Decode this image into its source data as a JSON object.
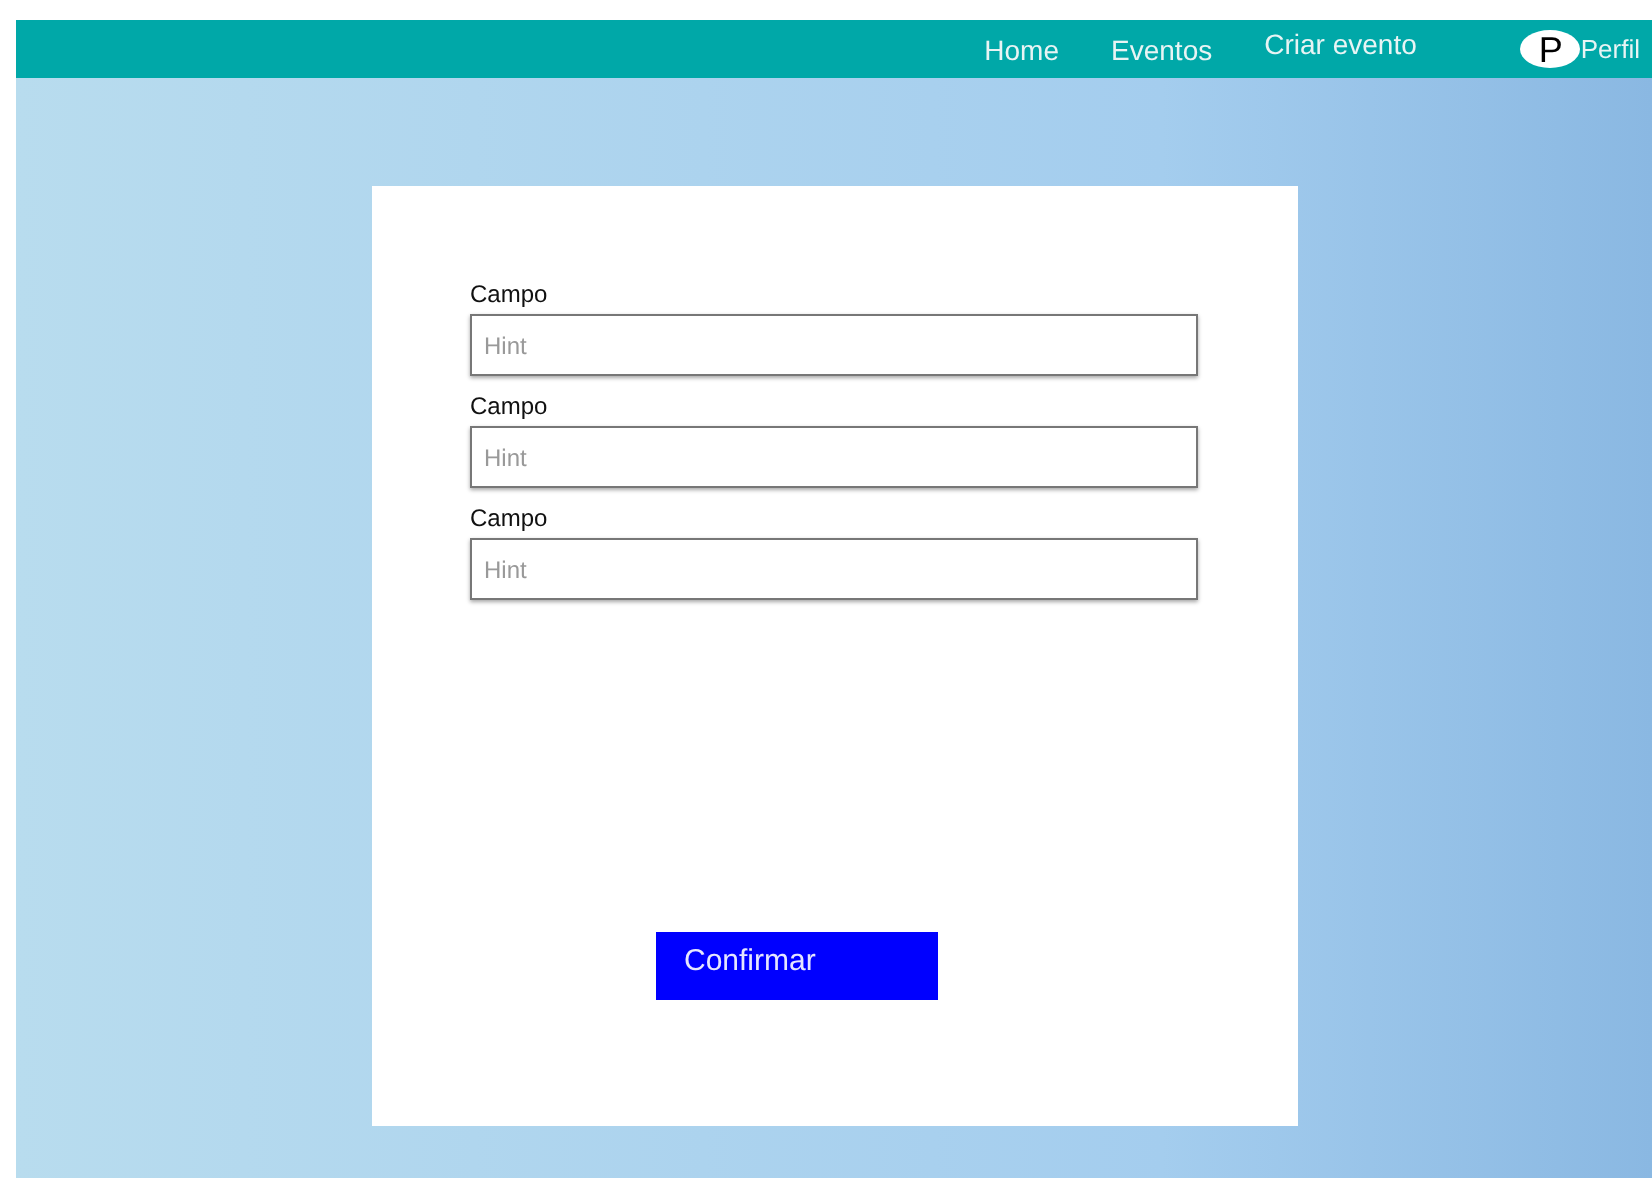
{
  "nav": {
    "links": [
      {
        "label": "Home"
      },
      {
        "label": "Eventos"
      },
      {
        "label": "Criar evento"
      }
    ],
    "profile": {
      "avatar_letter": "P",
      "label": "Perfil"
    }
  },
  "form": {
    "fields": [
      {
        "label": "Campo",
        "placeholder": "Hint"
      },
      {
        "label": "Campo",
        "placeholder": "Hint"
      },
      {
        "label": "Campo",
        "placeholder": "Hint"
      }
    ],
    "submit": "Confirmar"
  }
}
